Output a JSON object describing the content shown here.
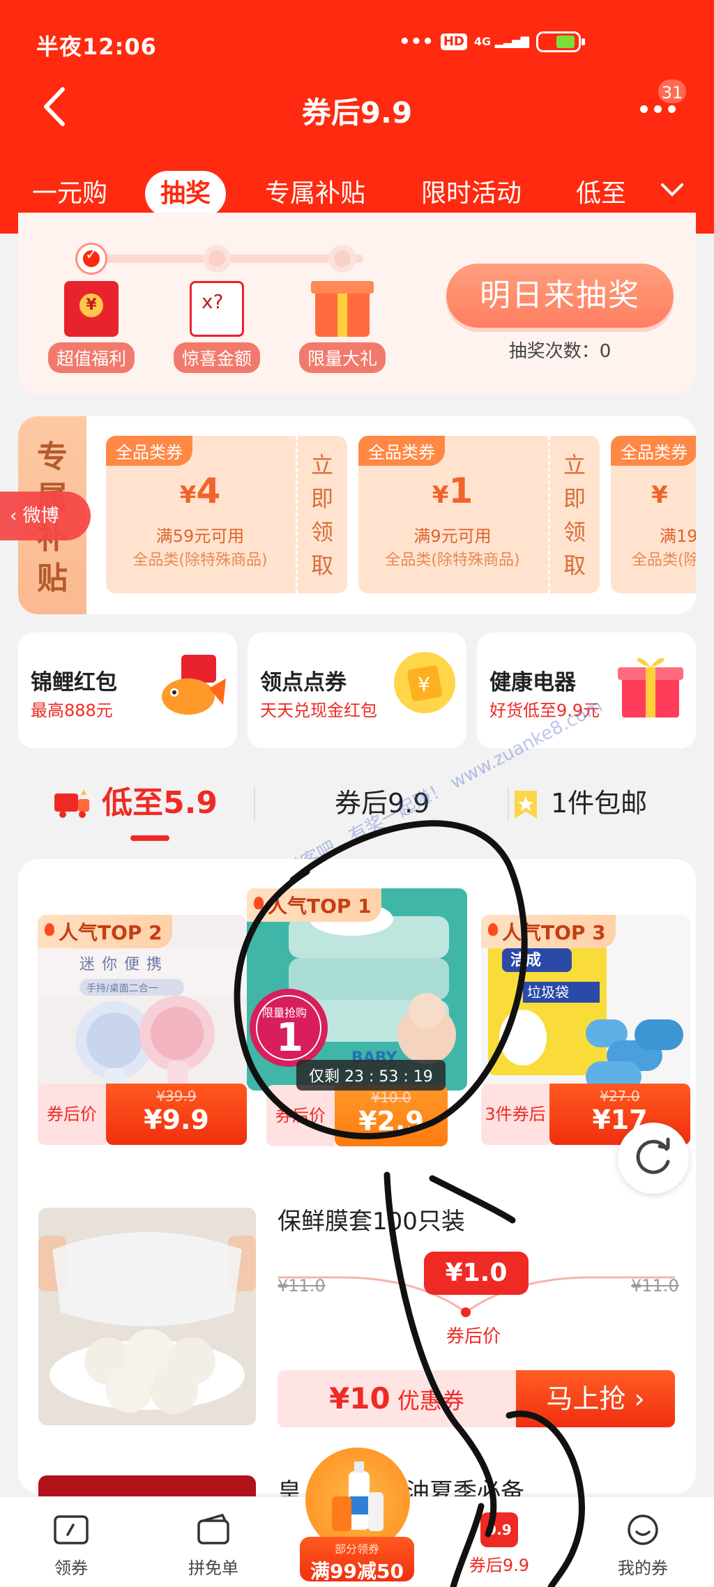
{
  "status_bar": {
    "time": "半夜12:06",
    "hd": "HD",
    "network": "4G"
  },
  "header": {
    "title": "券后9.9",
    "message_count": "31"
  },
  "tabs": [
    {
      "label": "一元购"
    },
    {
      "label": "抽奖"
    },
    {
      "label": "专属补贴"
    },
    {
      "label": "限时活动"
    },
    {
      "label": "低至"
    }
  ],
  "lottery": {
    "rewards": [
      {
        "label": "超值福利",
        "icon": "red-envelope-icon"
      },
      {
        "label": "惊喜金额",
        "icon": "mystery-note-icon"
      },
      {
        "label": "限量大礼",
        "icon": "gift-box-icon"
      }
    ],
    "button": "明日来抽奖",
    "count_label": "抽奖次数：0"
  },
  "subsidy": {
    "side_title": "专属补贴",
    "coupons": [
      {
        "tag": "全品类券",
        "currency": "¥",
        "amount": "4",
        "condition": "满59元可用",
        "scope": "全品类(除特殊商品)",
        "claim": "立即领取"
      },
      {
        "tag": "全品类券",
        "currency": "¥",
        "amount": "1",
        "condition": "满9元可用",
        "scope": "全品类(除特殊商品)",
        "claim": "立即领取"
      },
      {
        "tag": "全品类券",
        "currency": "¥",
        "amount": "",
        "condition": "满19",
        "scope": "全品类(除",
        "claim": ""
      }
    ]
  },
  "weibo_back": "微博",
  "entries": [
    {
      "title": "锦鲤红包",
      "subtitle": "最高888元"
    },
    {
      "title": "领点点券",
      "subtitle": "天天兑现金红包"
    },
    {
      "title": "健康电器",
      "subtitle": "好货低至9.9元"
    }
  ],
  "category_tabs": [
    {
      "label": "低至5.9"
    },
    {
      "label": "券后9.9"
    },
    {
      "label": "1件包邮"
    }
  ],
  "watermark": "赚客吧，有奖一起赚！ www.zuanke8.com",
  "top_products": [
    {
      "badge": "人气TOP 2",
      "price_label": "券后价",
      "old_price": "¥39.9",
      "price": "¥9.9"
    },
    {
      "badge": "人气TOP 1",
      "price_label": "券后价",
      "old_price": "¥10.0",
      "price": "¥2.9",
      "flash_tag": "限量抢购",
      "flash_num": "1",
      "countdown": "仅剩 23 : 53 : 19"
    },
    {
      "badge": "人气TOP 3",
      "price_label": "3件券后",
      "old_price": "¥27.0",
      "price": "¥17"
    }
  ],
  "list_item": {
    "title": "保鲜膜套100只装",
    "old_price_left": "¥11.0",
    "old_price_right": "¥11.0",
    "price": "¥1.0",
    "price_label": "券后价",
    "coupon_amount": "¥10",
    "coupon_label": "优惠券",
    "buy_button": "马上抢 ›"
  },
  "next_item": {
    "title_start": "皇",
    "title_end": "油夏季必备"
  },
  "bottom_nav": {
    "items": [
      {
        "label": "领券"
      },
      {
        "label": "拼免单"
      },
      {
        "label": "券后9.9",
        "icon_text": "9.9"
      },
      {
        "label": "我的券"
      }
    ],
    "promo": {
      "line1": "部分领券",
      "line2": "满99减50"
    }
  },
  "colors": {
    "brand_red": "#ff2a0f",
    "price_red": "#ef2a24",
    "coupon_orange": "#ff8844"
  }
}
